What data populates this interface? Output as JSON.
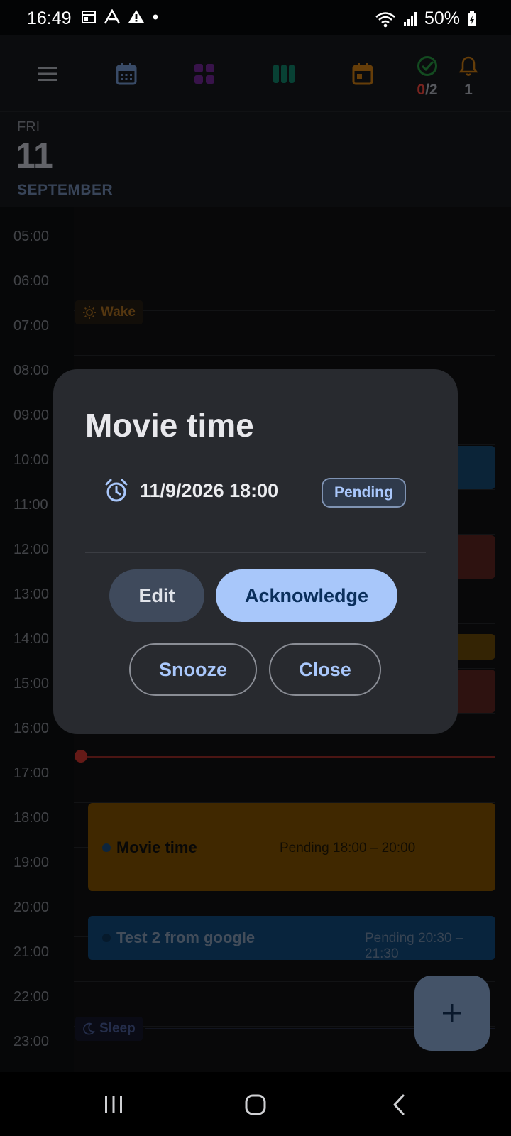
{
  "status_bar": {
    "time": "16:49",
    "battery": "50%"
  },
  "toolbar": {
    "tasks_done": "0",
    "tasks_total": "/2",
    "alarms_count": "1"
  },
  "date_header": {
    "weekday": "FRI",
    "day": "11",
    "month": "SEPTEMBER"
  },
  "hours": [
    "05:00",
    "06:00",
    "07:00",
    "08:00",
    "09:00",
    "10:00",
    "11:00",
    "12:00",
    "13:00",
    "14:00",
    "15:00",
    "16:00",
    "17:00",
    "18:00",
    "19:00",
    "20:00",
    "21:00",
    "22:00",
    "23:00"
  ],
  "markers": {
    "wake_label": "Wake",
    "sleep_label": "Sleep"
  },
  "events": [
    {
      "title": "Movie time",
      "status": "Pending",
      "time_range": "18:00 – 20:00",
      "color": "#684200"
    },
    {
      "title": "Test 2 from google",
      "status": "Pending",
      "time_range": "20:30 – 21:30",
      "color": "#0d3a63"
    }
  ],
  "dialog": {
    "title": "Movie time",
    "datetime": "11/9/2026 18:00",
    "status": "Pending",
    "buttons": {
      "edit": "Edit",
      "acknowledge": "Acknowledge",
      "snooze": "Snooze",
      "close": "Close"
    }
  },
  "colors": {
    "accent": "#a8c7fa",
    "event_orange": "#684200",
    "event_blue": "#0d3a63",
    "now_line": "#a32b26"
  },
  "icons": [
    "menu-icon",
    "calendar-grid-icon",
    "apps-grid-icon",
    "columns-icon",
    "event-icon",
    "check-circle-icon",
    "bell-icon",
    "alarm-icon",
    "sun-icon",
    "moon-icon",
    "plus-icon"
  ]
}
